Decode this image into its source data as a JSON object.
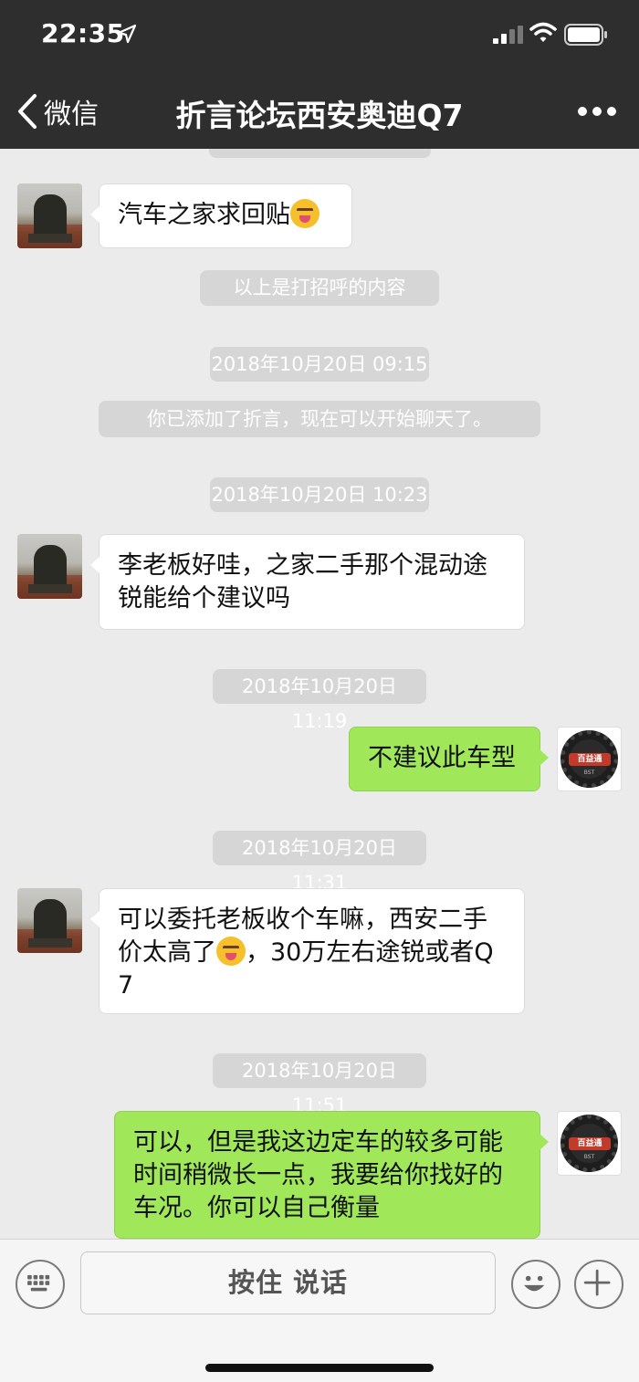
{
  "status_bar": {
    "time": "22:35",
    "icons": [
      "location-arrow-icon",
      "signal-icon",
      "wifi-icon",
      "battery-icon"
    ]
  },
  "nav": {
    "back_label": "微信",
    "title": "折言论坛西安奥迪Q7",
    "more_icon": "more-dots-icon"
  },
  "messages": [
    {
      "type": "incoming",
      "text": "汽车之家求回贴",
      "emoji": "squinting-tongue-emoji"
    },
    {
      "type": "system",
      "text": "以上是打招呼的内容"
    },
    {
      "type": "timestamp",
      "text": "2018年10月20日 09:15"
    },
    {
      "type": "system",
      "text": "你已添加了折言，现在可以开始聊天了。"
    },
    {
      "type": "timestamp",
      "text": "2018年10月20日 10:23"
    },
    {
      "type": "incoming",
      "text": "李老板好哇，之家二手那个混动途锐能给个建议吗"
    },
    {
      "type": "timestamp",
      "text": "2018年10月20日 11:19"
    },
    {
      "type": "outgoing",
      "text": "不建议此车型"
    },
    {
      "type": "timestamp",
      "text": "2018年10月20日 11:31"
    },
    {
      "type": "incoming",
      "text_a": "可以委托老板收个车嘛，西安二手价太高了",
      "emoji": "tearful-emoji",
      "text_b": "，30万左右途锐或者Q7"
    },
    {
      "type": "timestamp",
      "text": "2018年10月20日 11:51"
    },
    {
      "type": "outgoing",
      "text": "可以，但是我这边定车的较多可能时间稍微长一点，我要给你找好的车况。你可以自己衡量"
    }
  ],
  "avatar_logo_text": "百益通",
  "avatar_logo_subtext": "BST",
  "input_bar": {
    "hold_to_talk_label": "按住 说话",
    "icons": [
      "keyboard-icon",
      "emoji-face-icon",
      "plus-icon"
    ]
  },
  "colors": {
    "header_bg": "#2e2e2e",
    "chat_bg": "#ebebeb",
    "outgoing_bubble": "#a0e75a",
    "incoming_bubble": "#ffffff",
    "pill_bg": "#d6d6d6"
  }
}
